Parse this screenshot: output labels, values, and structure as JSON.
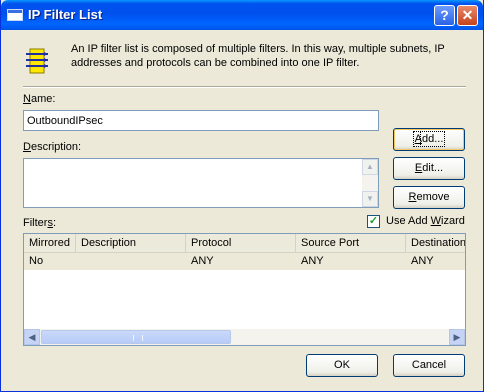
{
  "window": {
    "title": "IP Filter List"
  },
  "intro_text": "An IP filter list is composed of multiple filters. In this way, multiple subnets, IP addresses and protocols can be combined into one IP filter.",
  "name": {
    "label_underlined": "N",
    "label_rest": "ame:",
    "value": "OutboundIPsec"
  },
  "description": {
    "label_underlined": "D",
    "label_rest": "escription:",
    "value": ""
  },
  "buttons": {
    "add": {
      "u": "A",
      "rest": "dd..."
    },
    "edit": {
      "u": "E",
      "rest": "dit..."
    },
    "remove": {
      "u": "R",
      "rest": "emove"
    },
    "ok": "OK",
    "cancel": "Cancel"
  },
  "filters": {
    "label_pre": "Filter",
    "label_u": "s",
    "label_post": ":",
    "use_add_wizard": {
      "pre": "Use Add ",
      "u": "W",
      "post": "izard",
      "checked": true
    },
    "columns": [
      "Mirrored",
      "Description",
      "Protocol",
      "Source Port",
      "Destination"
    ],
    "rows": [
      {
        "mirrored": "No",
        "description": "",
        "protocol": "ANY",
        "source_port": "ANY",
        "destination": "ANY"
      }
    ]
  },
  "icons": {
    "title": "window-icon",
    "info": "filter-list-icon",
    "help": "help-icon",
    "close": "close-icon"
  }
}
